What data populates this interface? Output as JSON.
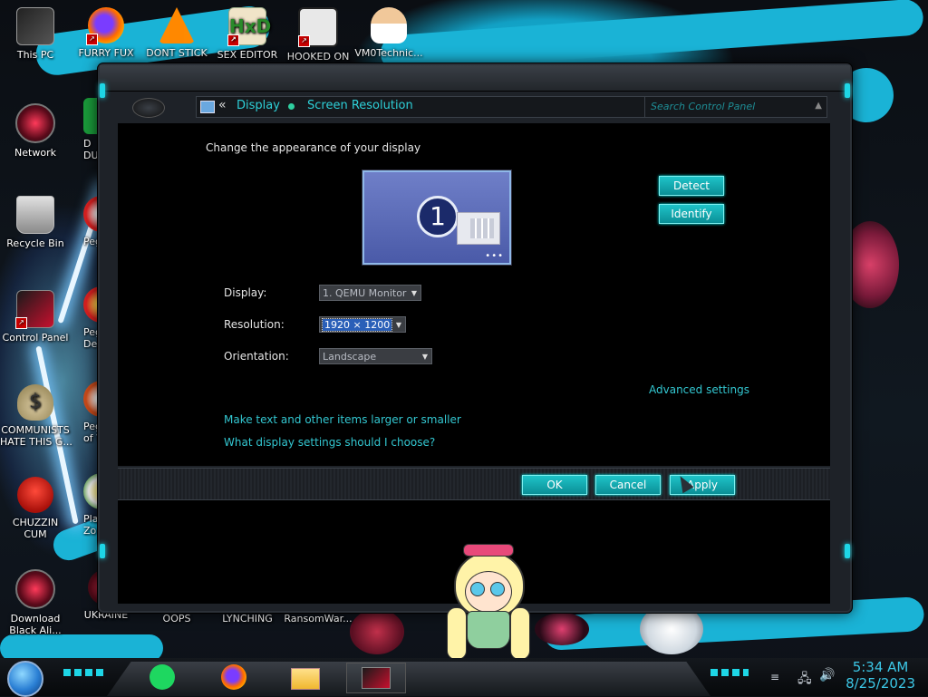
{
  "desktop": {
    "icons": [
      {
        "label": "This PC",
        "icon": "this-pc-icon"
      },
      {
        "label": "FURRY FUX",
        "icon": "firefox-icon"
      },
      {
        "label": "DONT STICK",
        "icon": "vlc-icon"
      },
      {
        "label": "SEX EDITOR",
        "icon": "hxd-icon"
      },
      {
        "label": "HOOKED ON",
        "icon": "app-icon"
      },
      {
        "label": "VM0Technic...",
        "icon": "doctor-icon"
      },
      {
        "label": "Network",
        "icon": "network-icon"
      },
      {
        "label": "D\nDUM",
        "icon": "app-icon"
      },
      {
        "label": "Recycle Bin",
        "icon": "recycle-bin-icon"
      },
      {
        "label": "Peggle",
        "icon": "peggle-icon"
      },
      {
        "label": "Control Panel",
        "icon": "control-panel-icon"
      },
      {
        "label": "Peggle\nDe",
        "icon": "peggle-icon"
      },
      {
        "label": "COMMUNISTS\nHATE THIS G...",
        "icon": "money-bag-icon"
      },
      {
        "label": "Peggle\nof Wa",
        "icon": "peggle-icon"
      },
      {
        "label": "CHUZZIN\nCUM",
        "icon": "chuzzle-icon"
      },
      {
        "label": "Plan\nZo",
        "icon": "flower-icon"
      },
      {
        "label": "Download\nBlack Ali...",
        "icon": "orb-icon"
      },
      {
        "label": "UKRAINE",
        "icon": "app-icon"
      },
      {
        "label": "OOPS",
        "icon": "blank-icon"
      },
      {
        "label": "LYNCHING",
        "icon": "blank-icon"
      },
      {
        "label": "RansomWar...",
        "icon": "blank-icon"
      }
    ]
  },
  "window": {
    "breadcrumb": [
      "Display",
      "Screen Resolution"
    ],
    "back_symbol": "«",
    "search_placeholder": "Search Control Panel",
    "heading": "Change the appearance of your display",
    "monitor_number": "1",
    "monitor_dots": "•••",
    "detect_label": "Detect",
    "identify_label": "Identify",
    "display_label": "Display:",
    "display_value": "1. QEMU Monitor",
    "resolution_label": "Resolution:",
    "resolution_value": "1920 × 1200",
    "orientation_label": "Orientation:",
    "orientation_value": "Landscape",
    "advanced_link": "Advanced settings",
    "link_text_size": "Make text and other items larger or smaller",
    "link_help": "What display settings should I choose?",
    "ok_label": "OK",
    "cancel_label": "Cancel",
    "apply_label": "Apply"
  },
  "taskbar": {
    "apps": [
      "notes-app-icon",
      "firefox-icon",
      "file-explorer-icon",
      "control-panel-icon"
    ],
    "time": "5:34 AM",
    "date": "8/25/2023"
  },
  "colors": {
    "accent": "#1ec3c8",
    "link": "#33c7d1",
    "clock": "#3cc7e6"
  }
}
